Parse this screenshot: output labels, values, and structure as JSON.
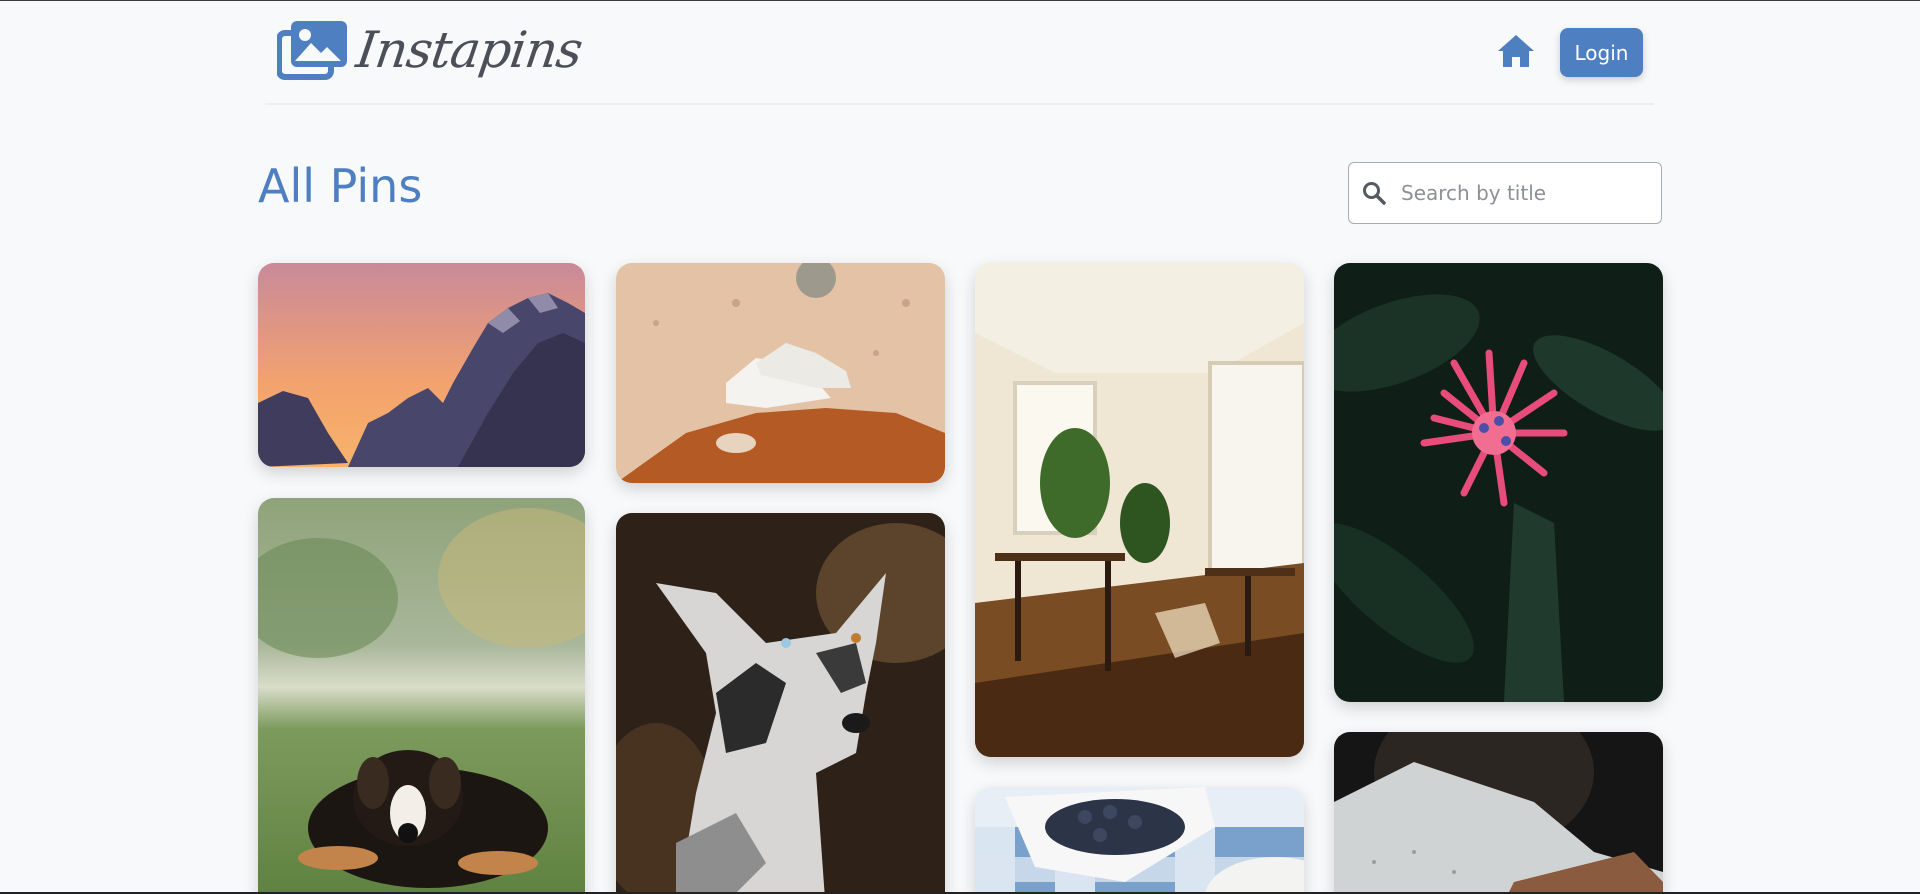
{
  "app": {
    "name": "Instapins",
    "accent_color": "#4e7fc1"
  },
  "header": {
    "logo_icon": "image-stack-icon",
    "home_icon": "home-icon",
    "login_label": "Login"
  },
  "main": {
    "title": "All Pins",
    "search": {
      "icon": "search-icon",
      "placeholder": "Search by title",
      "value": ""
    }
  },
  "pins": [
    {
      "subject": "mountain-sunset-pin-image"
    },
    {
      "subject": "sneakers-on-sand-pin-image"
    },
    {
      "subject": "cafe-interior-pin-image"
    },
    {
      "subject": "red-flower-pin-image"
    },
    {
      "subject": "bernese-dog-pin-image"
    },
    {
      "subject": "merle-dog-pin-image"
    },
    {
      "subject": "blueberries-pin-image"
    },
    {
      "subject": "man-shirt-pin-image"
    }
  ]
}
